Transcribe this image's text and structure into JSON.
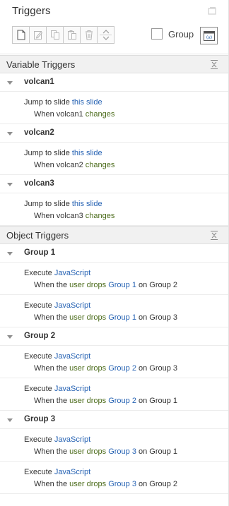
{
  "panel": {
    "title": "Triggers"
  },
  "toolbar": {
    "buttons": [
      "new-trigger",
      "edit-trigger",
      "copy-trigger",
      "paste-trigger",
      "delete-trigger"
    ],
    "group_label": "Group",
    "group_checked": false
  },
  "variable_section": {
    "title": "Variable Triggers",
    "groups": [
      {
        "name": "volcan1",
        "action_prefix": "Jump to slide",
        "action_link": "this slide",
        "when_prefix": "When volcan1",
        "when_link": "changes"
      },
      {
        "name": "volcan2",
        "action_prefix": "Jump to slide",
        "action_link": "this slide",
        "when_prefix": "When volcan2",
        "when_link": "changes"
      },
      {
        "name": "volcan3",
        "action_prefix": "Jump to slide",
        "action_link": "this slide",
        "when_prefix": "When volcan3",
        "when_link": "changes"
      }
    ]
  },
  "object_section": {
    "title": "Object Triggers",
    "groups": [
      {
        "name": "Group 1",
        "triggers": [
          {
            "action": "Execute",
            "action_link": "JavaScript",
            "when": "When the",
            "who": "user drops",
            "target": "Group 1",
            "on": "on Group 2"
          },
          {
            "action": "Execute",
            "action_link": "JavaScript",
            "when": "When the",
            "who": "user drops",
            "target": "Group 1",
            "on": "on Group 3"
          }
        ]
      },
      {
        "name": "Group 2",
        "triggers": [
          {
            "action": "Execute",
            "action_link": "JavaScript",
            "when": "When the",
            "who": "user drops",
            "target": "Group 2",
            "on": "on Group 3"
          },
          {
            "action": "Execute",
            "action_link": "JavaScript",
            "when": "When the",
            "who": "user drops",
            "target": "Group 2",
            "on": "on Group 1"
          }
        ]
      },
      {
        "name": "Group 3",
        "triggers": [
          {
            "action": "Execute",
            "action_link": "JavaScript",
            "when": "When the",
            "who": "user drops",
            "target": "Group 3",
            "on": "on Group 1"
          },
          {
            "action": "Execute",
            "action_link": "JavaScript",
            "when": "When the",
            "who": "user drops",
            "target": "Group 3",
            "on": "on Group 2"
          }
        ]
      }
    ]
  },
  "colors": {
    "link_blue": "#2864b4",
    "link_green": "#4b6b1a",
    "section_bg": "#f1f1f1"
  }
}
